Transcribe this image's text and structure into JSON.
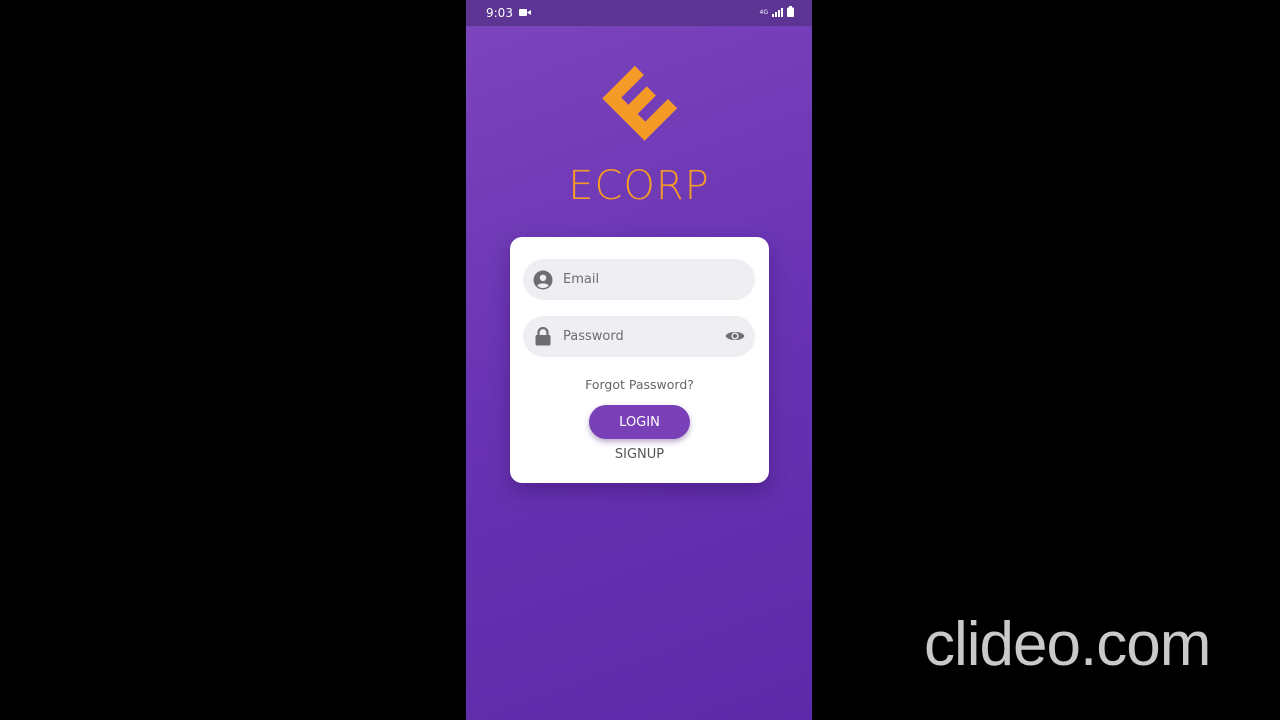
{
  "status_bar": {
    "time": "9:03",
    "network": "4G",
    "icons": [
      "video-camera-icon",
      "signal-icon",
      "battery-icon"
    ]
  },
  "brand": {
    "logo_icon": "ecorp-logo-icon",
    "name": "ECORP",
    "logo_color": "#f39a27"
  },
  "login_form": {
    "email_placeholder": "Email",
    "email_value": "",
    "password_placeholder": "Password",
    "password_value": "",
    "forgot_label": "Forgot Password?",
    "login_label": "LOGIN",
    "signup_label": "SIGNUP"
  },
  "watermark": {
    "text": "clideo.com"
  },
  "colors": {
    "accent": "#7a40b8",
    "background_top": "#7d46bd",
    "background_bottom": "#5c2aa8",
    "status_bar": "#5b3494"
  }
}
